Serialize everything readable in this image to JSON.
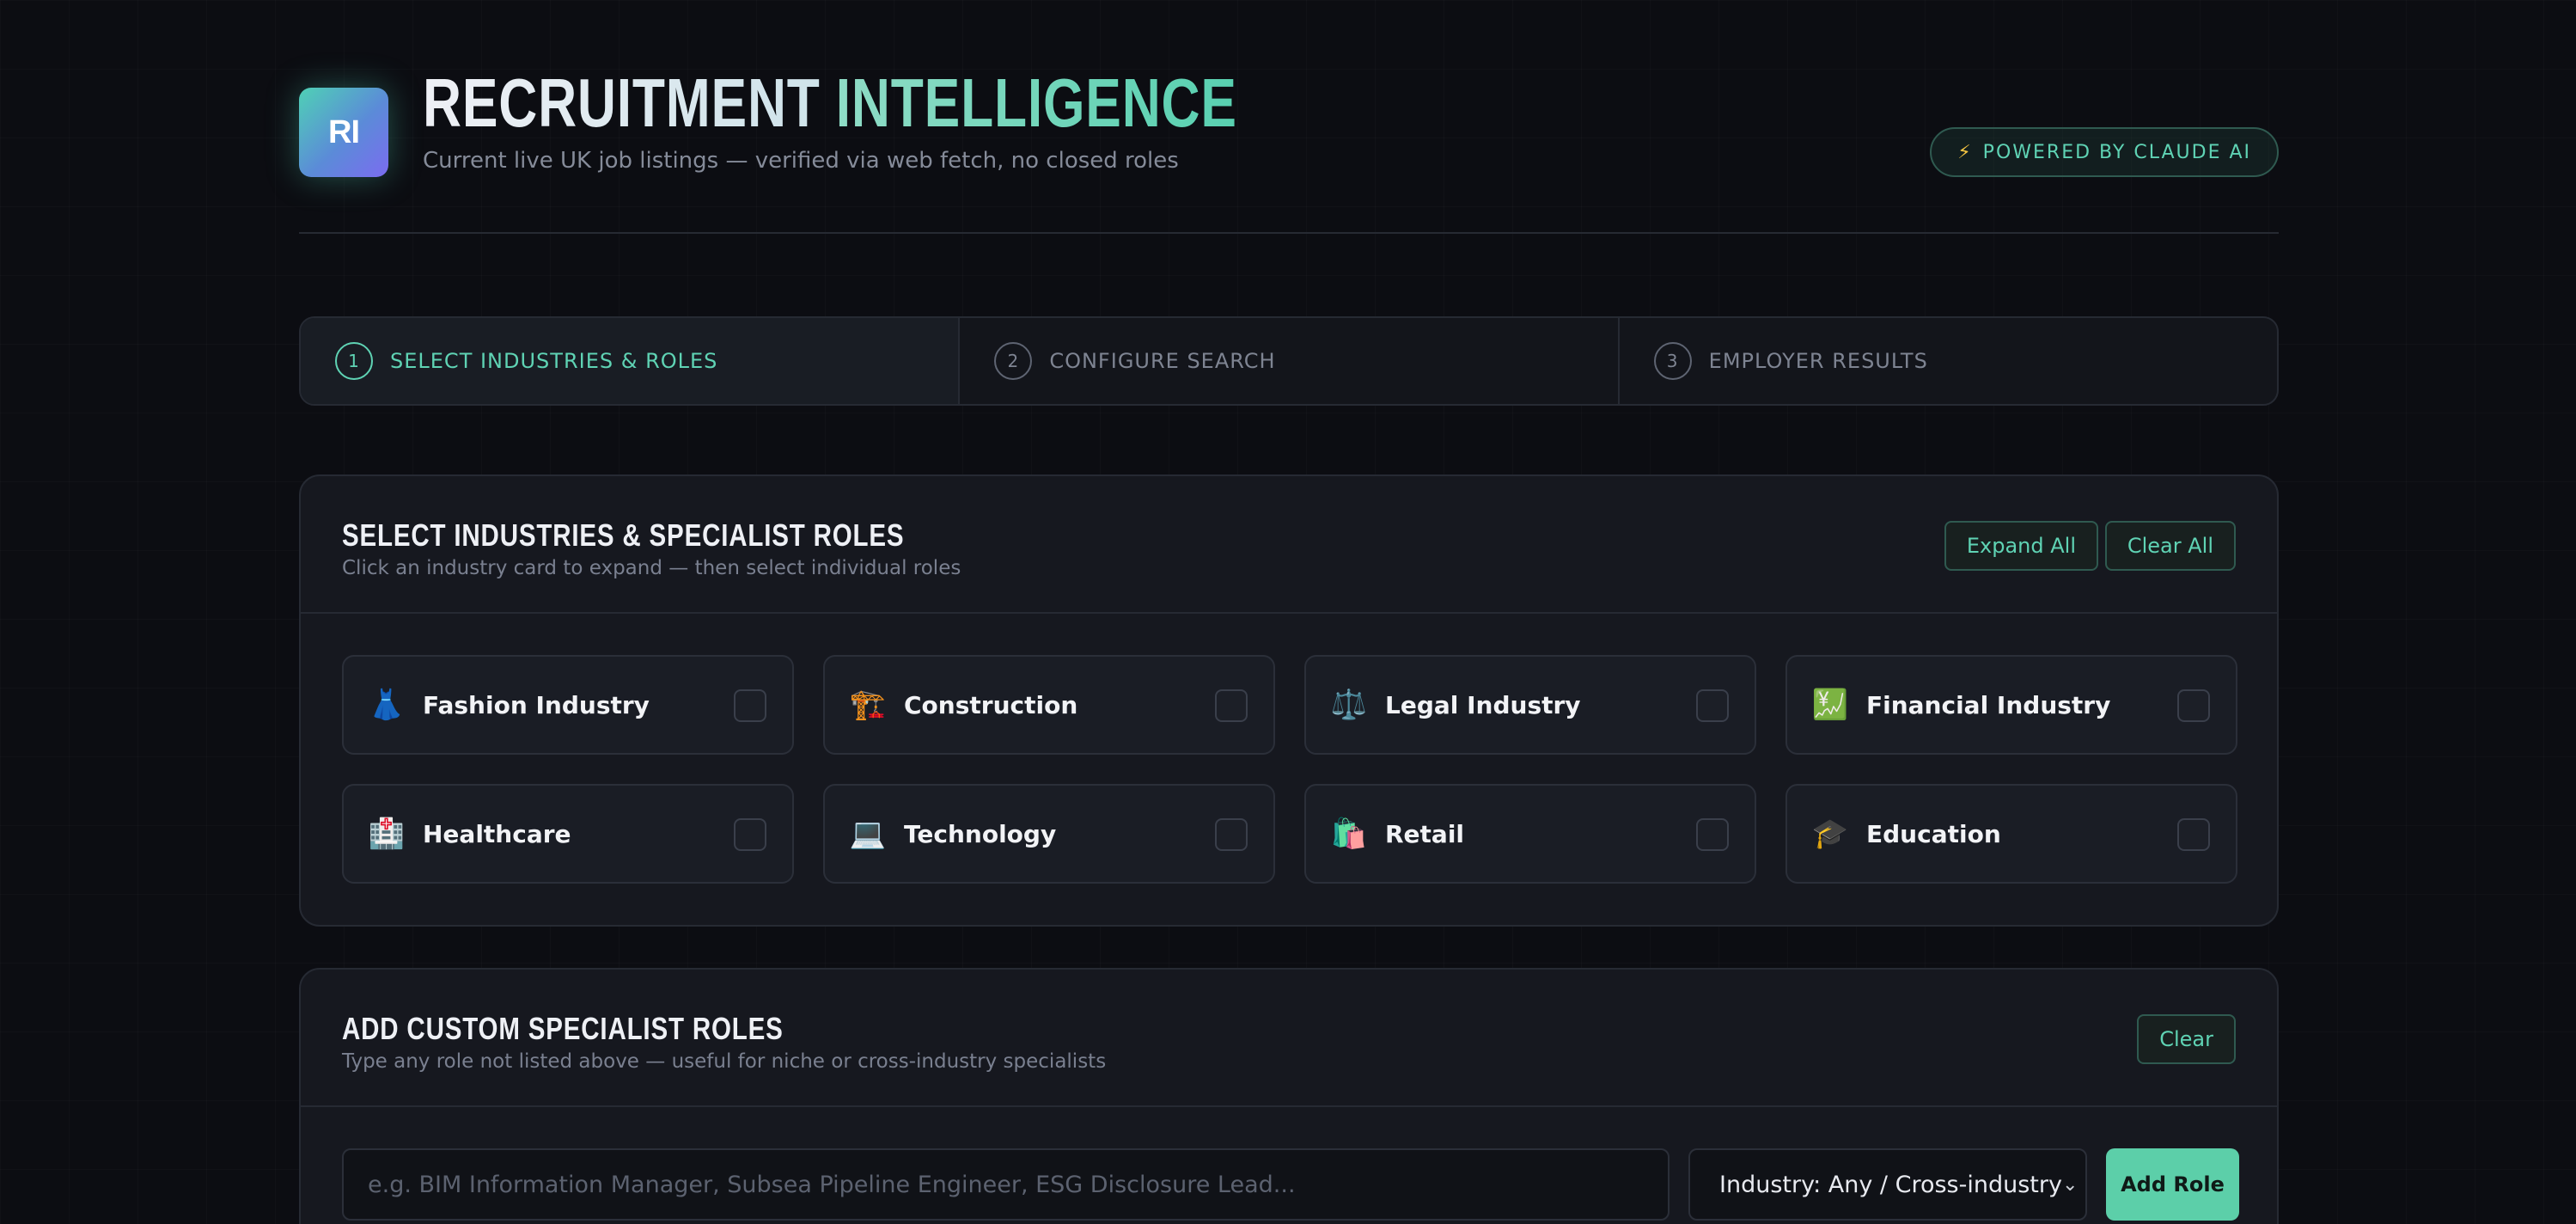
{
  "header": {
    "logo_text": "RI",
    "title_part1": "RECRUITMENT",
    "title_part2": "INTELLIGENCE",
    "subtitle": "Current live UK job listings — verified via web fetch, no closed roles",
    "badge_icon": "⚡",
    "badge_text": "POWERED BY CLAUDE AI"
  },
  "steps": [
    {
      "num": "1",
      "label": "SELECT INDUSTRIES & ROLES",
      "active": true
    },
    {
      "num": "2",
      "label": "CONFIGURE SEARCH",
      "active": false
    },
    {
      "num": "3",
      "label": "EMPLOYER RESULTS",
      "active": false
    }
  ],
  "industries_panel": {
    "title": "SELECT INDUSTRIES & SPECIALIST ROLES",
    "subtitle": "Click an industry card to expand — then select individual roles",
    "expand_all_label": "Expand All",
    "clear_all_label": "Clear All",
    "cards": [
      {
        "icon": "👗",
        "icon_name": "dress-icon",
        "label": "Fashion Industry"
      },
      {
        "icon": "🏗️",
        "icon_name": "crane-icon",
        "label": "Construction"
      },
      {
        "icon": "⚖️",
        "icon_name": "scales-icon",
        "label": "Legal Industry"
      },
      {
        "icon": "💹",
        "icon_name": "chart-yen-icon",
        "label": "Financial Industry"
      },
      {
        "icon": "🏥",
        "icon_name": "hospital-icon",
        "label": "Healthcare"
      },
      {
        "icon": "💻",
        "icon_name": "laptop-icon",
        "label": "Technology"
      },
      {
        "icon": "🛍️",
        "icon_name": "shopping-bags-icon",
        "label": "Retail"
      },
      {
        "icon": "🎓",
        "icon_name": "graduation-cap-icon",
        "label": "Education"
      }
    ]
  },
  "custom_panel": {
    "title": "ADD CUSTOM SPECIALIST ROLES",
    "subtitle": "Type any role not listed above — useful for niche or cross-industry specialists",
    "clear_label": "Clear",
    "input_placeholder": "e.g. BIM Information Manager, Subsea Pipeline Engineer, ESG Disclosure Lead...",
    "industry_select_value": "Industry: Any / Cross-industry",
    "add_role_label": "Add Role"
  },
  "colors": {
    "accent": "#5fd3b4",
    "background": "#0c0d12",
    "panel": "#16181f"
  }
}
